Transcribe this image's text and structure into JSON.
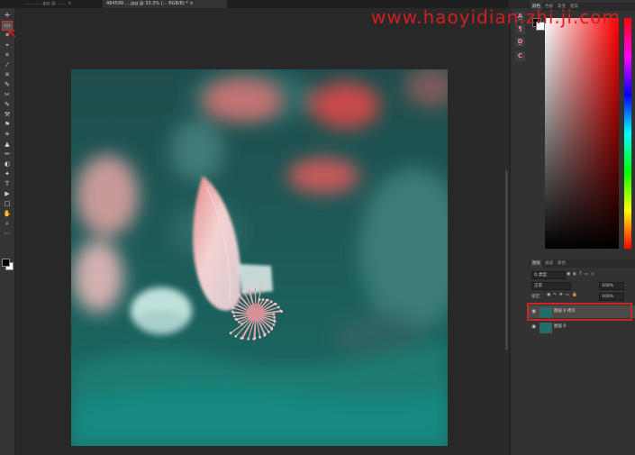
{
  "tabs": [
    {
      "label": "………….jpg @ …… ×",
      "active": false
    },
    {
      "label": "484599 ….jpg @ 33.3% (… RGB/8) * ×",
      "active": true
    }
  ],
  "toolbar": {
    "tools": [
      "✛",
      "▭",
      "✶",
      "⌖",
      "⌗",
      "⁄",
      "✕",
      "✎",
      "✂",
      "✎",
      "⚒",
      "⚑",
      "☀",
      "▲",
      "✏",
      "◐",
      "✦",
      "T",
      "▶",
      "□",
      "✋",
      "⌕",
      "⋯"
    ],
    "selected_index": 1,
    "fg_color": "#000000",
    "bg_color": "#ffffff"
  },
  "dock": {
    "icons": [
      "A̲",
      "¶",
      "D̲",
      "C"
    ]
  },
  "color_panel": {
    "tabs": [
      "颜色",
      "色板",
      "渐变",
      "图案"
    ],
    "hue_color": "#ff0000"
  },
  "layers_panel": {
    "tabs": [
      "图层",
      "通道",
      "路径"
    ],
    "filter_label": "Q 类型",
    "blend_mode": "正常",
    "opacity": "100%",
    "lock_label": "锁定:",
    "fill": "100%",
    "layers": [
      {
        "name": "图层 0 拷贝",
        "selected": true
      },
      {
        "name": "图层 0",
        "selected": false
      }
    ]
  },
  "watermark": {
    "text": "www.haoyidian.zhi.ji.com",
    "color": "#d41f1f"
  }
}
